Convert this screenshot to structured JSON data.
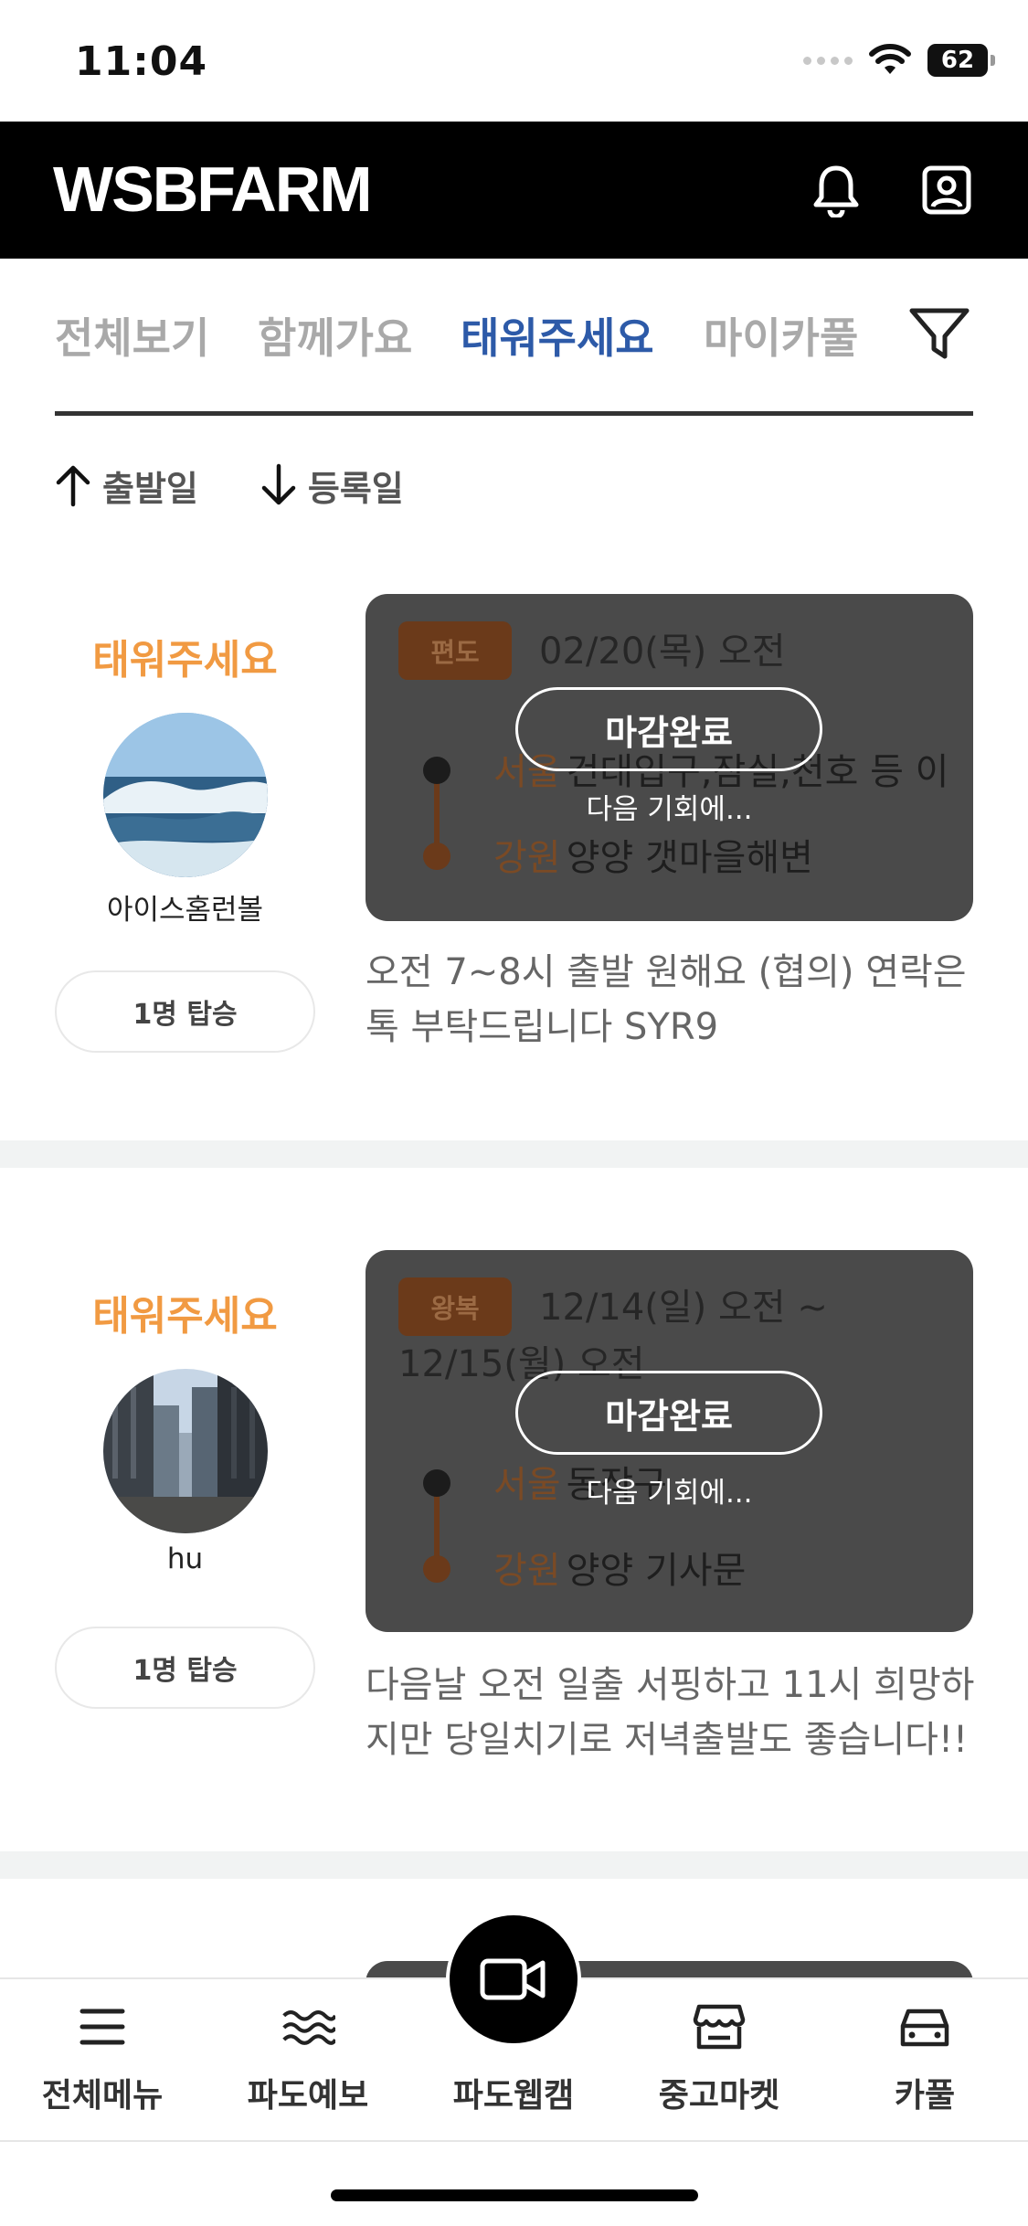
{
  "status_bar": {
    "time": "11:04",
    "battery": "62"
  },
  "header": {
    "logo_text": "WSBFARM"
  },
  "tabs": [
    {
      "label": "전체보기",
      "active": false
    },
    {
      "label": "함께가요",
      "active": false
    },
    {
      "label": "태워주세요",
      "active": true
    },
    {
      "label": "마이카풀",
      "active": false
    }
  ],
  "sort": {
    "departure": "출발일",
    "registered": "등록일"
  },
  "cards": [
    {
      "type_label": "태워주세요",
      "username": "아이스홈런볼",
      "passengers": "1명 탑승",
      "trip_type": "편도",
      "date": "02/20(목) 오전",
      "from_region": "서울",
      "from_place": "건대입구,잠실,천호 등 이",
      "to_region": "강원",
      "to_place": "양양 갯마을해변",
      "closed_label": "마감완료",
      "closed_sub": "다음 기회에...",
      "description": "오전 7~8시 출발 원해요 (협의) 연락은 톡 부탁드립니다 SYR9"
    },
    {
      "type_label": "태워주세요",
      "username": "hu",
      "passengers": "1명 탑승",
      "trip_type": "왕복",
      "date": "12/14(일) 오전 ~",
      "date2": "12/15(월) 오전",
      "from_region": "서울",
      "from_place": "동작구",
      "to_region": "강원",
      "to_place": "양양 기사문",
      "closed_label": "마감완료",
      "closed_sub": "다음 기회에...",
      "description": "다음날 오전 일출 서핑하고 11시 희망하지만 당일치기로 저녁출발도 좋습니다!!"
    }
  ],
  "bottom_nav": [
    {
      "label": "전체메뉴",
      "icon": "menu-icon"
    },
    {
      "label": "파도예보",
      "icon": "wave-icon"
    },
    {
      "label": "파도웹캠",
      "icon": "video-camera-icon"
    },
    {
      "label": "중고마켓",
      "icon": "store-icon"
    },
    {
      "label": "카풀",
      "icon": "car-icon"
    }
  ],
  "colors": {
    "accent_blue": "#2d5aa8",
    "accent_orange": "#f19a42",
    "header_bg": "#000000"
  }
}
